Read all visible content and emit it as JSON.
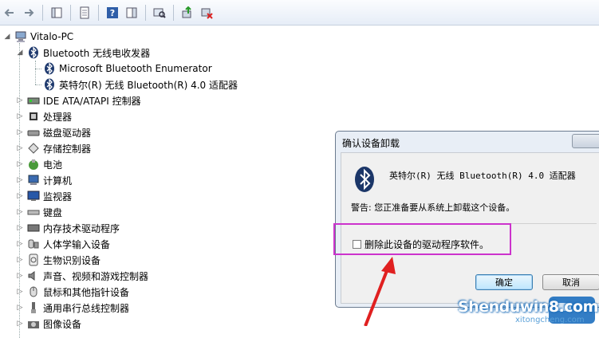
{
  "tree": {
    "root": "Vitalo-PC",
    "bluetooth_group": "Bluetooth 无线电收发器",
    "bt_children": [
      "Microsoft Bluetooth Enumerator",
      "英特尔(R) 无线 Bluetooth(R) 4.0 适配器"
    ],
    "categories": [
      "IDE ATA/ATAPI 控制器",
      "处理器",
      "磁盘驱动器",
      "存储控制器",
      "电池",
      "计算机",
      "监视器",
      "键盘",
      "内存技术驱动程序",
      "人体学输入设备",
      "生物识别设备",
      "声音、视频和游戏控制器",
      "鼠标和其他指针设备",
      "通用串行总线控制器",
      "图像设备"
    ]
  },
  "dialog": {
    "title": "确认设备卸载",
    "device_name": "英特尔(R) 无线 Bluetooth(R) 4.0 适配器",
    "warning": "警告: 您正准备要从系统上卸载这个设备。",
    "checkbox_label": "删除此设备的驱动程序软件。",
    "checkbox_checked": false,
    "ok_label": "确定",
    "cancel_label": "取消"
  },
  "watermark": {
    "main": "Shenduwin8.com",
    "sub": "xitongcheng.com"
  }
}
